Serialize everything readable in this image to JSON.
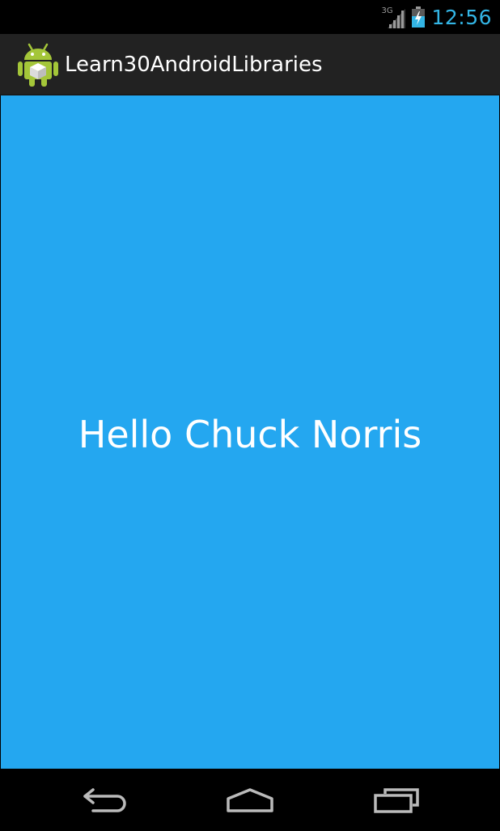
{
  "status_bar": {
    "network": "3G",
    "time": "12:56"
  },
  "action_bar": {
    "title": "Learn30AndroidLibraries",
    "icon": "android-robot-icon"
  },
  "content": {
    "message": "Hello Chuck Norris",
    "background": "#24a7f0"
  },
  "nav_bar": {
    "back_icon": "back-arrow-icon",
    "home_icon": "home-icon",
    "recent_icon": "recent-apps-icon"
  },
  "colors": {
    "accent": "#33b5e5",
    "action_bar_bg": "#222222",
    "status_bar_bg": "#000000"
  }
}
